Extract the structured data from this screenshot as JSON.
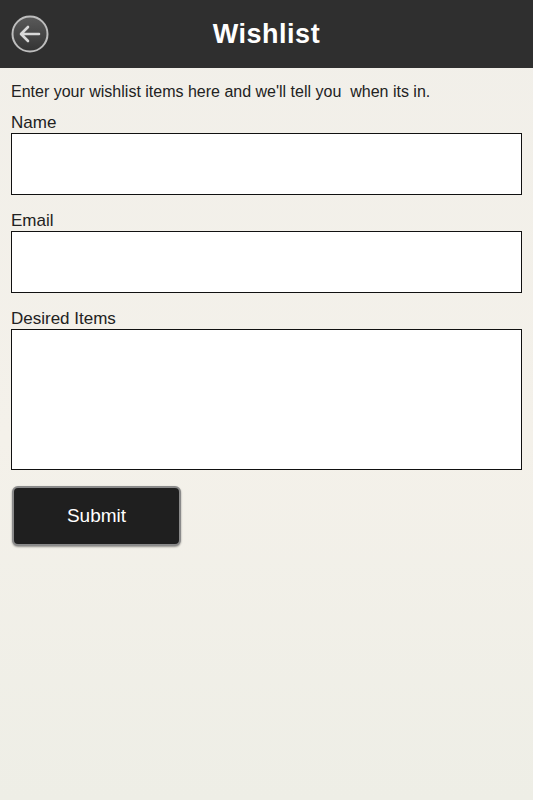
{
  "header": {
    "title": "Wishlist"
  },
  "intro": "Enter your wishlist items here and we'll tell you  when its in.",
  "fields": [
    {
      "label": "Name",
      "kind": "input"
    },
    {
      "label": "Email",
      "kind": "input"
    },
    {
      "label": "Desired Items",
      "kind": "textarea"
    }
  ],
  "buttons": [
    "Submit"
  ]
}
